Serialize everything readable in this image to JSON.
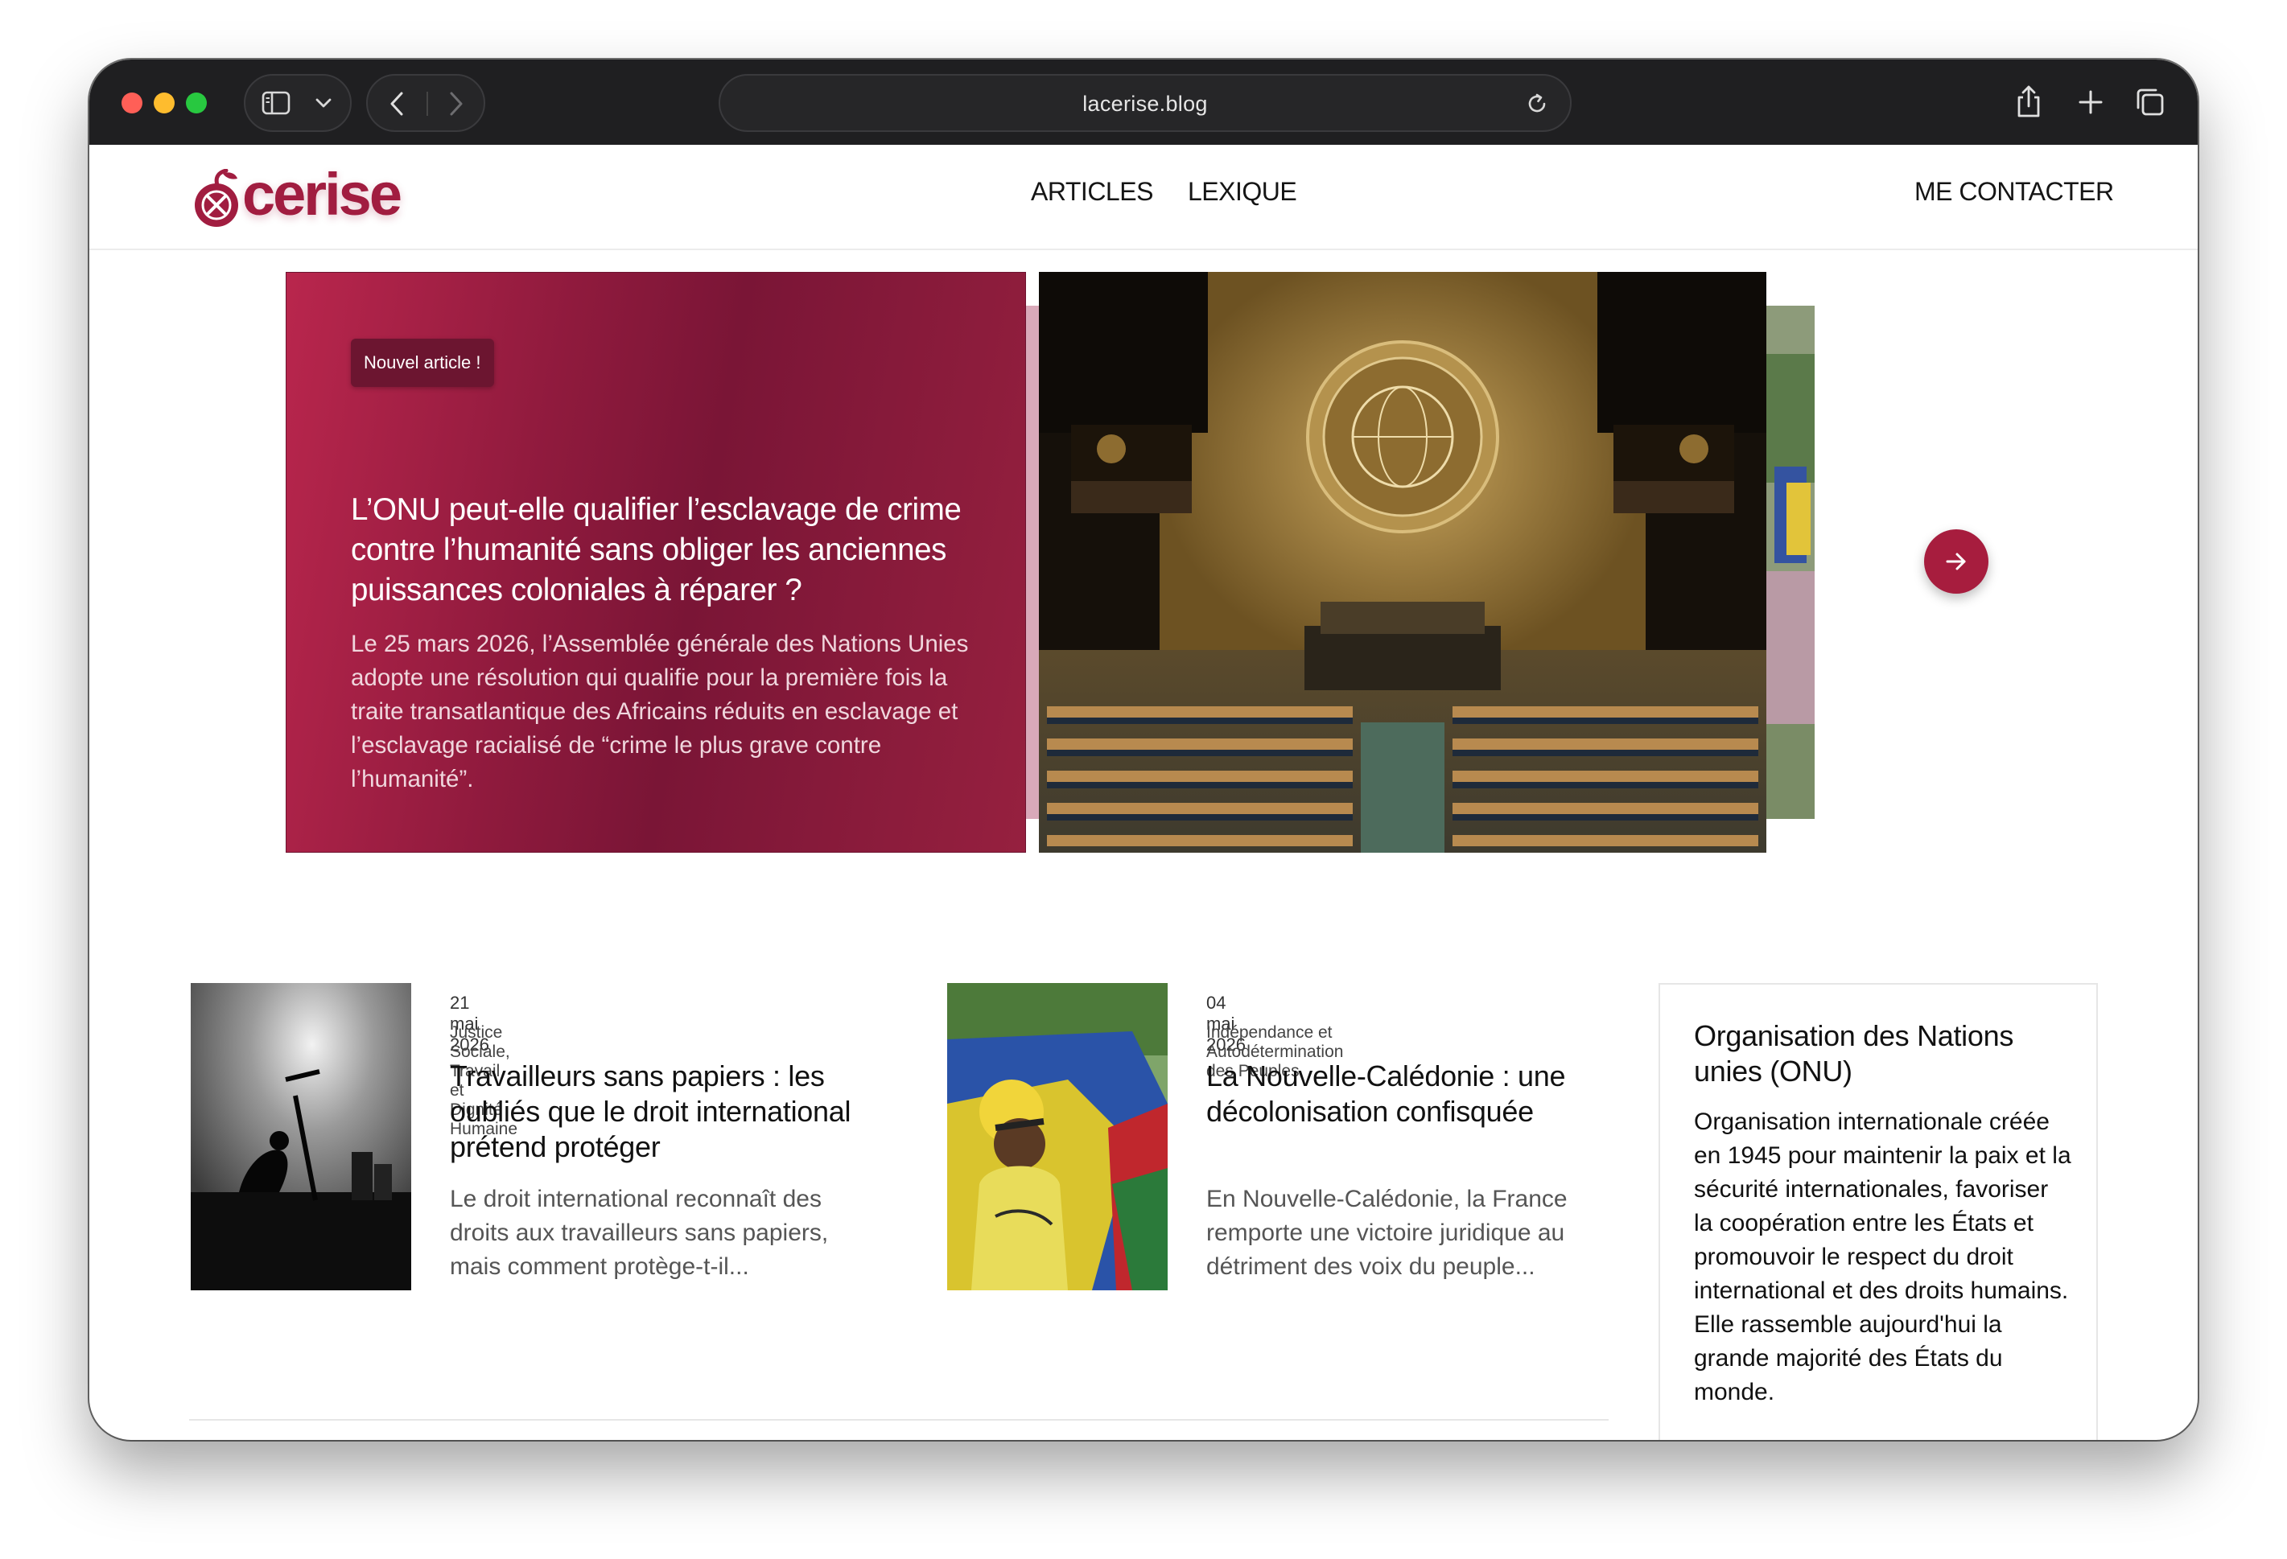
{
  "browser": {
    "url": "lacerise.blog"
  },
  "site": {
    "logo_text": "cerise",
    "nav": {
      "articles": "ARTICLES",
      "lexique": "LEXIQUE",
      "contact": "ME CONTACTER"
    }
  },
  "hero": {
    "badge": "Nouvel article !",
    "title": "L’ONU peut-elle qualifier l’esclavage de crime contre l’humanité sans obliger les anciennes puissances coloniales à réparer ?",
    "excerpt": "Le 25 mars 2026, l’Assemblée générale des Nations Unies adopte une résolution qui qualifie pour la première fois la traite transatlantique des Africains réduits en esclavage et l’esclavage racialisé de “crime le plus grave contre l’humanité”."
  },
  "articles": [
    {
      "date": "21 mai 2026",
      "category": "Justice Sociale, Travail et Dignité Humaine",
      "title": "Travailleurs sans papiers : les oubliés que le droit international prétend protéger",
      "excerpt": "Le droit international reconnaît des droits aux travailleurs sans papiers, mais comment protège-t-il..."
    },
    {
      "date": "04 mai 2026",
      "category": "Indépendance et Autodétermination des Peuples",
      "title": "La Nouvelle-Calédonie : une décolonisation confisquée",
      "excerpt": "En Nouvelle-Calédonie, la France remporte une victoire juridique au détriment des voix du peuple..."
    }
  ],
  "lexicon": {
    "title": "Organisation des Nations unies (ONU)",
    "text": "Organisation internationale créée en 1945 pour maintenir la paix et la sécurité internationales, favoriser la coopération entre les États et promouvoir le respect du droit international et des droits humains. Elle rassemble aujourd'hui la grande majorité des États du monde."
  },
  "colors": {
    "brand": "#a11d40",
    "accent_button": "#a71d3e",
    "chrome": "#1f1f21"
  }
}
